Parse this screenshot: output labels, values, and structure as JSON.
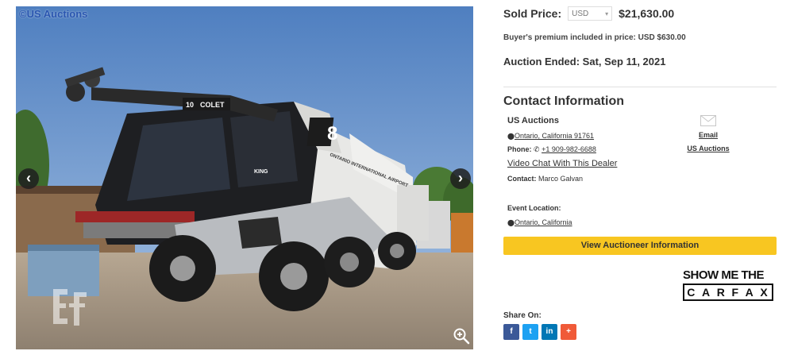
{
  "gallery": {
    "watermark": "©US Auctions",
    "prev_label": "‹",
    "next_label": "›",
    "zoom_icon": "zoom-in-icon",
    "brand_logo": "ef-logo",
    "vehicle_text": {
      "boom_label": "COLET",
      "boom_number": "10",
      "cab_number": "8",
      "cab_brand": "KING",
      "side_text": "ONTARIO INTERNATIONAL AIRPORT"
    }
  },
  "sold": {
    "label": "Sold Price:",
    "currency": "USD",
    "price": "$21,630.00"
  },
  "premium_text": "Buyer's premium included in price: USD $630.00",
  "auction_ended": {
    "label": "Auction Ended:",
    "date": "Sat, Sep 11, 2021"
  },
  "contact": {
    "heading": "Contact Information",
    "name": "US Auctions",
    "location": "Ontario, California 91761",
    "phone_label": "Phone:",
    "phone": "+1 909-982-6688",
    "video_chat": "Video Chat With This Dealer",
    "contact_label": "Contact:",
    "contact_name": "Marco Galvan",
    "event_location_label": "Event Location:",
    "event_location": "Ontario, California",
    "email_label": "Email",
    "email_sub": "US Auctions"
  },
  "view_button": "View Auctioneer Information",
  "carfax": {
    "top": "SHOW ME THE",
    "letters": [
      "C",
      "A",
      "R",
      "F",
      "A",
      "X"
    ]
  },
  "share": {
    "label": "Share On:",
    "buttons": [
      "f",
      "t",
      "in",
      "+"
    ]
  },
  "colors": {
    "accent_button": "#f8c621",
    "facebook": "#3b5998",
    "twitter": "#1da1f2",
    "linkedin": "#0077b5",
    "share_more": "#f05a38"
  }
}
